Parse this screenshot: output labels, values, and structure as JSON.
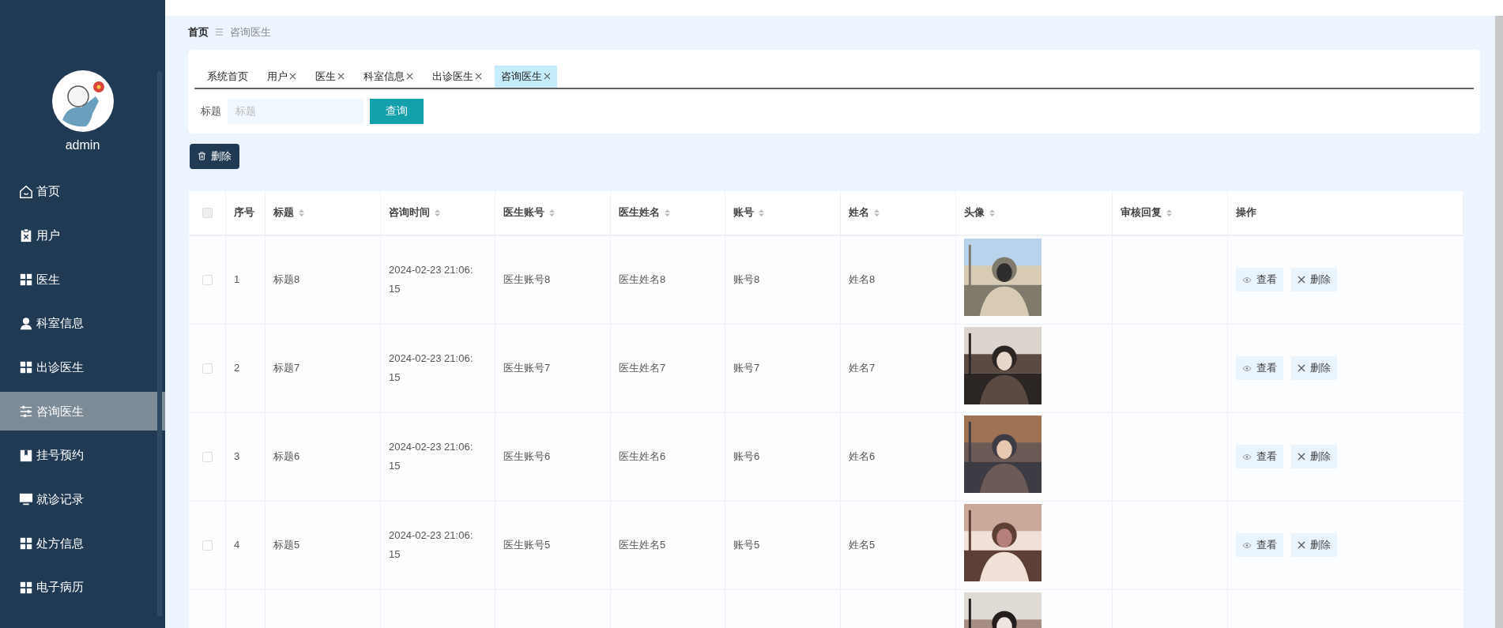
{
  "sidebar": {
    "user": "admin",
    "items": [
      {
        "label": "首页",
        "kind": "home",
        "selected": false
      },
      {
        "label": "用户",
        "kind": "clipboard",
        "selected": false
      },
      {
        "label": "医生",
        "kind": "grid",
        "selected": false
      },
      {
        "label": "科室信息",
        "kind": "person",
        "selected": false
      },
      {
        "label": "出诊医生",
        "kind": "grid",
        "selected": false
      },
      {
        "label": "咨询医生",
        "kind": "sliders",
        "selected": true
      },
      {
        "label": "挂号预约",
        "kind": "book",
        "selected": false
      },
      {
        "label": "就诊记录",
        "kind": "monitor",
        "selected": false
      },
      {
        "label": "处方信息",
        "kind": "grid",
        "selected": false
      },
      {
        "label": "电子病历",
        "kind": "grid",
        "selected": false
      }
    ]
  },
  "breadcrumb": [
    "首页",
    "咨询医生"
  ],
  "tabs": [
    {
      "label": "系统首页",
      "closable": false,
      "selected": false
    },
    {
      "label": "用户",
      "closable": true,
      "selected": false
    },
    {
      "label": "医生",
      "closable": true,
      "selected": false
    },
    {
      "label": "科室信息",
      "closable": true,
      "selected": false
    },
    {
      "label": "出诊医生",
      "closable": true,
      "selected": false
    },
    {
      "label": "咨询医生",
      "closable": true,
      "selected": true
    }
  ],
  "search": {
    "label": "标题",
    "placeholder": "标题",
    "button": "查询"
  },
  "delete_button": "删除",
  "table": {
    "select_all": {
      "checked": false
    },
    "columns": [
      {
        "label": "序号",
        "sortable": false
      },
      {
        "label": "标题",
        "sortable": true
      },
      {
        "label": "咨询时间",
        "sortable": true
      },
      {
        "label": "医生账号",
        "sortable": true
      },
      {
        "label": "医生姓名",
        "sortable": true
      },
      {
        "label": "账号",
        "sortable": true
      },
      {
        "label": "姓名",
        "sortable": true
      },
      {
        "label": "头像",
        "sortable": true
      },
      {
        "label": "审核回复",
        "sortable": true
      },
      {
        "label": "操作",
        "sortable": false
      }
    ],
    "rows": [
      {
        "checked": false,
        "cells": [
          "1",
          "标题8",
          "2024-02-23 21:06:15",
          "医生账号8",
          "医生姓名8",
          "账号8",
          "姓名8"
        ],
        "avatar": {
          "kind": "picture"
        },
        "actions": [
          "查看",
          "删除"
        ]
      },
      {
        "checked": false,
        "cells": [
          "2",
          "标题7",
          "2024-02-23 21:06:15",
          "医生账号7",
          "医生姓名7",
          "账号7",
          "姓名7"
        ],
        "avatar": {
          "kind": "picture"
        },
        "actions": [
          "查看",
          "删除"
        ]
      },
      {
        "checked": false,
        "cells": [
          "3",
          "标题6",
          "2024-02-23 21:06:15",
          "医生账号6",
          "医生姓名6",
          "账号6",
          "姓名6"
        ],
        "avatar": {
          "kind": "picture"
        },
        "actions": [
          "查看",
          "删除"
        ]
      },
      {
        "checked": false,
        "cells": [
          "4",
          "标题5",
          "2024-02-23 21:06:15",
          "医生账号5",
          "医生姓名5",
          "账号5",
          "姓名5"
        ],
        "avatar": {
          "kind": "picture"
        },
        "actions": [
          "查看",
          "删除"
        ]
      },
      {
        "avatar": {
          "kind": "picture"
        }
      }
    ]
  }
}
